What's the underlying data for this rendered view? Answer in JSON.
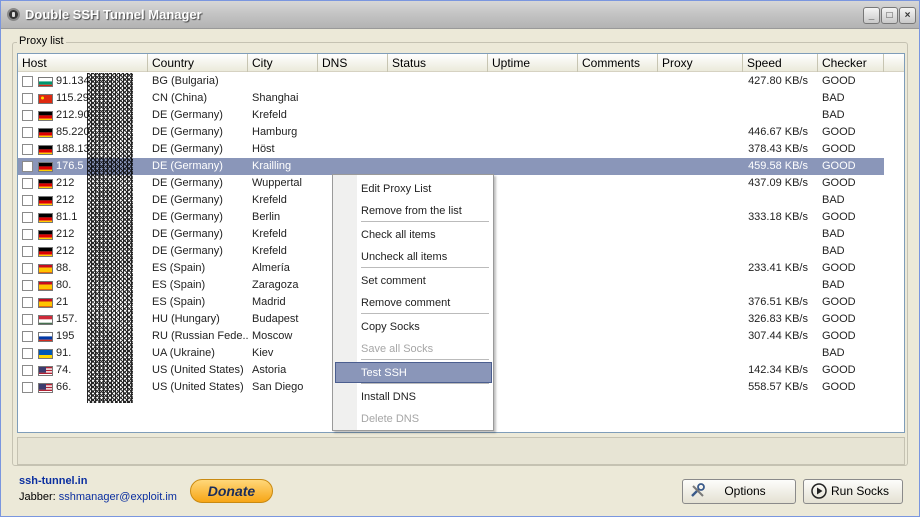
{
  "window": {
    "title": "Double SSH Tunnel Manager"
  },
  "group": {
    "label": "Proxy list"
  },
  "columns": [
    "Host",
    "Country",
    "City",
    "DNS",
    "Status",
    "Uptime",
    "Comments",
    "Proxy",
    "Speed",
    "Checker"
  ],
  "rows": [
    {
      "host": "91.134",
      "flag": "bg",
      "country": "BG (Bulgaria)",
      "city": "",
      "speed": "427.80 KB/s",
      "checker": "GOOD"
    },
    {
      "host": "115.29.",
      "flag": "cn",
      "country": "CN (China)",
      "city": "Shanghai",
      "speed": "",
      "checker": "BAD"
    },
    {
      "host": "212.90.",
      "flag": "de",
      "country": "DE (Germany)",
      "city": "Krefeld",
      "speed": "",
      "checker": "BAD"
    },
    {
      "host": "85.220",
      "flag": "de",
      "country": "DE (Germany)",
      "city": "Hamburg",
      "speed": "446.67 KB/s",
      "checker": "GOOD"
    },
    {
      "host": "188.13",
      "flag": "de",
      "country": "DE (Germany)",
      "city": "Höst",
      "speed": "378.43 KB/s",
      "checker": "GOOD"
    },
    {
      "host": "176.5",
      "flag": "de",
      "country": "DE (Germany)",
      "city": "Krailling",
      "speed": "459.58 KB/s",
      "checker": "GOOD",
      "selected": true
    },
    {
      "host": "212",
      "flag": "de",
      "country": "DE (Germany)",
      "city": "Wuppertal",
      "speed": "437.09 KB/s",
      "checker": "GOOD"
    },
    {
      "host": "212",
      "flag": "de",
      "country": "DE (Germany)",
      "city": "Krefeld",
      "speed": "",
      "checker": "BAD"
    },
    {
      "host": "81.1",
      "flag": "de",
      "country": "DE (Germany)",
      "city": "Berlin",
      "speed": "333.18 KB/s",
      "checker": "GOOD"
    },
    {
      "host": "212",
      "flag": "de",
      "country": "DE (Germany)",
      "city": "Krefeld",
      "speed": "",
      "checker": "BAD"
    },
    {
      "host": "212",
      "flag": "de",
      "country": "DE (Germany)",
      "city": "Krefeld",
      "speed": "",
      "checker": "BAD"
    },
    {
      "host": "88.",
      "flag": "es",
      "country": "ES (Spain)",
      "city": "Almería",
      "speed": "233.41 KB/s",
      "checker": "GOOD"
    },
    {
      "host": "80.",
      "flag": "es",
      "country": "ES (Spain)",
      "city": "Zaragoza",
      "speed": "",
      "checker": "BAD"
    },
    {
      "host": "21",
      "flag": "es",
      "country": "ES (Spain)",
      "city": "Madrid",
      "speed": "376.51 KB/s",
      "checker": "GOOD"
    },
    {
      "host": "157.",
      "flag": "hu",
      "country": "HU (Hungary)",
      "city": "Budapest",
      "speed": "326.83 KB/s",
      "checker": "GOOD"
    },
    {
      "host": "195",
      "flag": "ru",
      "country": "RU (Russian Fede...",
      "city": "Moscow",
      "speed": "307.44 KB/s",
      "checker": "GOOD"
    },
    {
      "host": "91.",
      "flag": "ua",
      "country": "UA (Ukraine)",
      "city": "Kiev",
      "speed": "",
      "checker": "BAD"
    },
    {
      "host": "74.",
      "flag": "us",
      "country": "US (United States)",
      "city": "Astoria",
      "speed": "142.34 KB/s",
      "checker": "GOOD"
    },
    {
      "host": "66.",
      "flag": "us",
      "country": "US (United States)",
      "city": "San Diego",
      "speed": "558.57 KB/s",
      "checker": "GOOD"
    }
  ],
  "context_menu": [
    {
      "label": "Edit Proxy List",
      "disabled": false
    },
    {
      "label": "Remove from the list",
      "disabled": false
    },
    {
      "sep": true
    },
    {
      "label": "Check all items",
      "disabled": false
    },
    {
      "label": "Uncheck all items",
      "disabled": false
    },
    {
      "sep": true
    },
    {
      "label": "Set comment",
      "disabled": false
    },
    {
      "label": "Remove comment",
      "disabled": false
    },
    {
      "sep": true
    },
    {
      "label": "Copy Socks",
      "disabled": false
    },
    {
      "label": "Save all Socks",
      "disabled": true
    },
    {
      "sep": true
    },
    {
      "label": "Test SSH",
      "disabled": false,
      "highlighted": true
    },
    {
      "sep": true
    },
    {
      "label": "Install DNS",
      "disabled": false
    },
    {
      "label": "Delete DNS",
      "disabled": true
    }
  ],
  "footer": {
    "site": "ssh-tunnel.in",
    "jabber_label": "Jabber:",
    "jabber_address": "sshmanager@exploit.im",
    "donate": "Donate",
    "options": "Options",
    "run_socks": "Run Socks"
  },
  "colors": {
    "selection": "#8a96b9",
    "link": "#0b2fa0",
    "donate": "#f7a616"
  }
}
